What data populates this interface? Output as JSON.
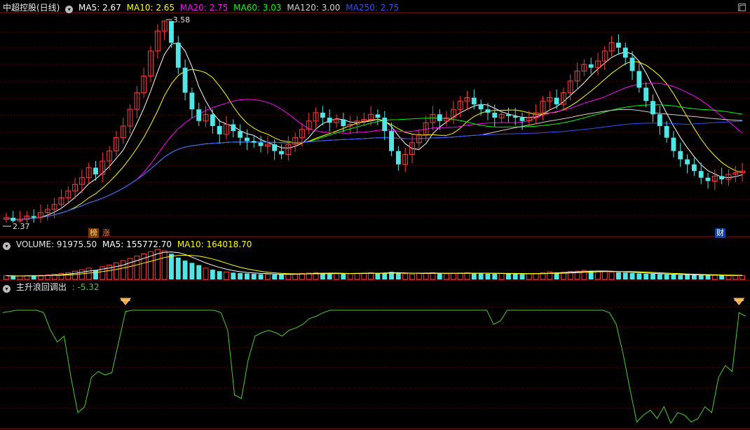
{
  "price_panel": {
    "title": "中超控股(日线)",
    "indicators": [
      {
        "label": "MA5: 2.67",
        "color": "#ffffff"
      },
      {
        "label": "MA10: 2.65",
        "color": "#ffff00"
      },
      {
        "label": "MA20: 2.75",
        "color": "#ff00ff"
      },
      {
        "label": "MA60: 3.03",
        "color": "#00ff00"
      },
      {
        "label": "MA120: 3.00",
        "color": "#d0d0d0"
      },
      {
        "label": "MA250: 2.75",
        "color": "#3050ff"
      }
    ],
    "high_label": "3.58",
    "low_label": "2.37",
    "badge_bang": "榜",
    "badge_zhang": "涨",
    "badge_cai": "财"
  },
  "volume_panel": {
    "title": "VOLUME: 91975.50",
    "ma5": "MA5: 155772.70",
    "ma10": "MA10: 164018.70"
  },
  "indicator_panel": {
    "title": "主升浪回调出",
    "value": ": -5.32",
    "line_color": "#4ccc2c"
  },
  "colors": {
    "up": "#ff3c3c",
    "down": "#50e6e6",
    "grid": "#8a0000",
    "background": "#000000"
  },
  "chart_data": [
    {
      "type": "candlestick",
      "title": "中超控股(日线)",
      "ylim": [
        2.37,
        3.58
      ],
      "high": 3.58,
      "low": 2.37,
      "ma_last": {
        "MA5": 2.67,
        "MA10": 2.65,
        "MA20": 2.75,
        "MA60": 3.03,
        "MA120": 3.0,
        "MA250": 2.75
      },
      "close_series": [
        2.4,
        2.38,
        2.39,
        2.41,
        2.4,
        2.43,
        2.45,
        2.48,
        2.52,
        2.56,
        2.6,
        2.64,
        2.7,
        2.66,
        2.74,
        2.8,
        2.88,
        2.95,
        3.05,
        3.15,
        3.25,
        3.4,
        3.52,
        3.58,
        3.45,
        3.3,
        3.15,
        3.05,
        2.98,
        3.02,
        2.95,
        2.9,
        2.96,
        2.92,
        2.88,
        2.86,
        2.85,
        2.83,
        2.84,
        2.8,
        2.78,
        2.84,
        2.88,
        2.93,
        2.98,
        3.03,
        3.0,
        2.97,
        2.99,
        2.95,
        2.96,
        2.98,
        2.99,
        3.02,
        3.0,
        2.92,
        2.8,
        2.72,
        2.78,
        2.85,
        2.9,
        2.97,
        3.02,
        2.98,
        3.0,
        3.05,
        3.1,
        3.12,
        3.08,
        3.05,
        3.03,
        3.0,
        3.02,
        3.01,
        3.0,
        2.98,
        3.0,
        3.03,
        3.1,
        3.12,
        3.08,
        3.15,
        3.22,
        3.28,
        3.32,
        3.3,
        3.34,
        3.4,
        3.45,
        3.42,
        3.36,
        3.28,
        3.18,
        3.1,
        3.02,
        2.95,
        2.88,
        2.8,
        2.75,
        2.72,
        2.68,
        2.64,
        2.62,
        2.65,
        2.63,
        2.66,
        2.67,
        2.68
      ]
    },
    {
      "type": "bar",
      "title": "VOLUME",
      "last": 91975.5,
      "ma5": 155772.7,
      "ma10": 164018.7,
      "values": [
        10,
        9,
        9,
        10,
        10,
        11,
        12,
        14,
        16,
        18,
        22,
        26,
        30,
        25,
        34,
        38,
        44,
        50,
        56,
        62,
        68,
        74,
        80,
        76,
        68,
        58,
        50,
        44,
        38,
        30,
        26,
        22,
        20,
        18,
        17,
        16,
        15,
        14,
        14,
        13,
        13,
        14,
        15,
        16,
        17,
        18,
        17,
        16,
        16,
        15,
        15,
        16,
        17,
        18,
        16,
        18,
        20,
        17,
        15,
        14,
        16,
        17,
        18,
        16,
        15,
        16,
        17,
        18,
        17,
        16,
        15,
        15,
        16,
        15,
        15,
        14,
        15,
        16,
        18,
        20,
        18,
        19,
        21,
        22,
        24,
        23,
        22,
        21,
        20,
        19,
        18,
        17,
        16,
        15,
        15,
        14,
        13,
        13,
        12,
        12,
        12,
        11,
        11,
        11,
        11,
        10,
        10,
        10
      ]
    },
    {
      "type": "line",
      "title": "主升浪回调出",
      "last": -5.32,
      "ylim": [
        -100,
        0
      ],
      "values": [
        -5,
        -4,
        -3,
        -3,
        -3,
        -3,
        -5,
        -20,
        -30,
        -25,
        -60,
        -90,
        -85,
        -60,
        -55,
        -58,
        -56,
        -30,
        -4,
        -3,
        -3,
        -3,
        -3,
        -3,
        -3,
        -3,
        -3,
        -3,
        -3,
        -3,
        -3,
        -3,
        -5,
        -20,
        -75,
        -78,
        -45,
        -25,
        -22,
        -20,
        -22,
        -25,
        -20,
        -18,
        -15,
        -10,
        -8,
        -5,
        -3,
        -3,
        -3,
        -3,
        -3,
        -3,
        -3,
        -3,
        -3,
        -3,
        -3,
        -3,
        -3,
        -3,
        -3,
        -3,
        -3,
        -3,
        -3,
        -3,
        -3,
        -3,
        -3,
        -3,
        -15,
        -12,
        -3,
        -3,
        -3,
        -3,
        -3,
        -3,
        -3,
        -3,
        -3,
        -3,
        -3,
        -3,
        -3,
        -3,
        -3,
        -5,
        -15,
        -40,
        -70,
        -98,
        -92,
        -88,
        -95,
        -85,
        -99,
        -90,
        -92,
        -98,
        -95,
        -85,
        -90,
        -60,
        -50,
        -55,
        -5,
        -8
      ]
    }
  ]
}
